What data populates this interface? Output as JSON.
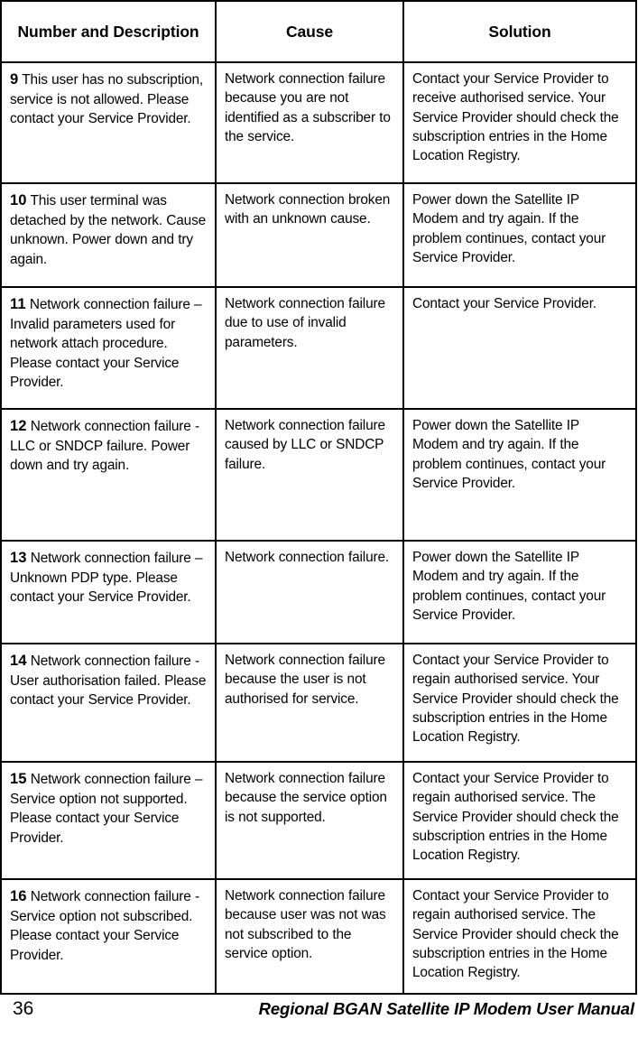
{
  "document": {
    "page_number": "36",
    "footer_title": "Regional BGAN Satellite IP Modem User Manual"
  },
  "table": {
    "headers": {
      "number_and_description": "Number and Description",
      "cause": "Cause",
      "solution": "Solution"
    },
    "rows": [
      {
        "index": "9",
        "description": "This user has no subscription, service is not allowed. Please contact your Service Provider.",
        "cause": "Network connection failure because you are not identified as a subscriber to the service.",
        "solution": "Contact your Service Provider to receive authorised service. Your Service Provider should check the subscription entries in the Home Location Registry."
      },
      {
        "index": "10",
        "description": "This user terminal was detached by the network. Cause unknown. Power down and try again.",
        "cause": "Network connection broken with an unknown cause.",
        "solution": "Power down the Satellite IP Modem and try again. If the problem continues, contact your Service Provider."
      },
      {
        "index": "11",
        "description": "Network connection failure – Invalid parameters used for network attach procedure. Please contact your Service Provider.",
        "cause": "Network connection failure due to use of invalid parameters.",
        "solution": "Contact your Service Provider."
      },
      {
        "index": "12",
        "description": "Network connection failure - LLC or SNDCP failure. Power down and try again.",
        "cause": "Network connection failure caused by LLC or SNDCP failure.",
        "solution": "Power down the Satellite IP Modem and try again. If the problem continues, contact your Service Provider."
      },
      {
        "index": "13",
        "description": "Network connection failure – Unknown PDP type. Please contact your Service Provider.",
        "cause": "Network connection failure.",
        "solution": "Power down the Satellite IP Modem and try again. If the problem continues, contact your Service Provider."
      },
      {
        "index": "14",
        "description": "Network connection failure - User authorisation failed. Please contact your Service Provider.",
        "cause": "Network connection failure because the user is not authorised for service.",
        "solution": "Contact your Service Provider to regain authorised service. Your Service Provider should check the subscription entries in the Home Location Registry."
      },
      {
        "index": "15",
        "description": "Network connection failure – Service option not supported. Please contact your Service Provider.",
        "cause": "Network connection failure because the service option is not supported.",
        "solution": "Contact your Service Provider to regain authorised service. The Service Provider should check the subscription entries in the Home Location Registry."
      },
      {
        "index": "16",
        "description": "Network connection failure - Service option not subscribed. Please contact your Service Provider.",
        "cause": "Network connection failure because user was not was not subscribed to the service option.",
        "solution": "Contact your Service Provider to regain authorised service. The Service Provider should check the subscription entries in the Home Location Registry."
      }
    ]
  }
}
